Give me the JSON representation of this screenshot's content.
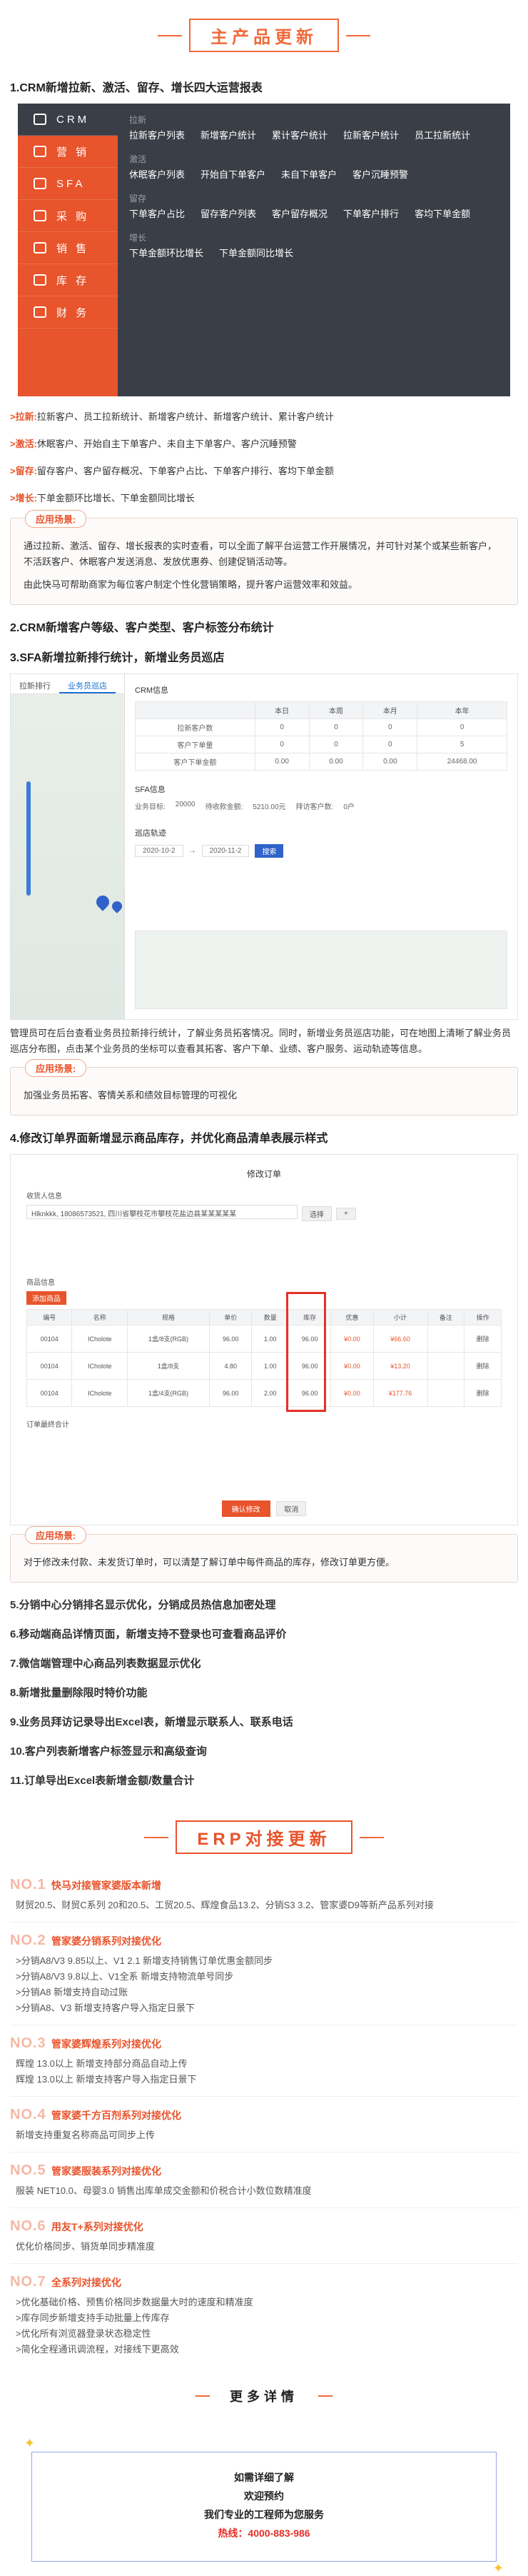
{
  "main_update": {
    "heading": "主产品更新",
    "item1": {
      "title": "1.CRM新增拉新、激活、留存、增长四大运营报表",
      "menu": {
        "nav": [
          "CRM",
          "营 销",
          "SFA",
          "采 购",
          "销 售",
          "库 存",
          "财 务"
        ],
        "groups": [
          {
            "title": "拉新",
            "items": [
              "拉新客户列表",
              "新增客户统计",
              "累计客户统计",
              "拉新客户统计",
              "员工拉新统计"
            ]
          },
          {
            "title": "激活",
            "items": [
              "休眠客户列表",
              "开始自下单客户",
              "未自下单客户",
              "客户沉睡预警"
            ]
          },
          {
            "title": "留存",
            "items": [
              "下单客户占比",
              "留存客户列表",
              "客户留存概况",
              "下单客户排行",
              "客均下单金额"
            ]
          },
          {
            "title": "增长",
            "items": [
              "下单金额环比增长",
              "下单金额同比增长"
            ]
          }
        ]
      },
      "bullets": [
        {
          "key": ">拉新:",
          "text": "拉新客户、员工拉新统计、新增客户统计、新增客户统计、累计客户统计"
        },
        {
          "key": ">激活:",
          "text": "休眠客户、开始自主下单客户、未自主下单客户、客户沉睡预警"
        },
        {
          "key": ">留存:",
          "text": "留存客户、客户留存概况、下单客户占比、下单客户排行、客均下单金额"
        },
        {
          "key": ">增长:",
          "text": "下单金额环比增长、下单金额同比增长"
        }
      ],
      "scene_tag": "应用场景:",
      "scene_text": [
        "通过拉新、激活、留存、增长报表的实时查看，可以全面了解平台运营工作开展情况，并可针对某个或某些新客户，不活跃客户、休眠客户发送消息、发放优惠券、创建促销活动等。",
        "由此快马可帮助商家为每位客户制定个性化营销策略，提升客户运营效率和效益。"
      ]
    },
    "item2": {
      "title": "2.CRM新增客户等级、客户类型、客户标签分布统计"
    },
    "item3": {
      "title": "3.SFA新增拉新排行统计，新增业务员巡店",
      "shot": {
        "tabs": [
          "拉新排行",
          "业务员巡店"
        ],
        "section1": "CRM信息",
        "cols": [
          "",
          "本日",
          "本周",
          "本月",
          "本年"
        ],
        "rows": [
          [
            "拉新客户数",
            "0",
            "0",
            "0",
            "0"
          ],
          [
            "客户下单量",
            "0",
            "0",
            "0",
            "5"
          ],
          [
            "客户下单金额",
            "0.00",
            "0.00",
            "0.00",
            "24468.00"
          ]
        ],
        "section2": "SFA信息",
        "info": [
          "业务目标:",
          "20000",
          "待收款金额:",
          "5210.00元",
          "拜访客户数:",
          "0户"
        ],
        "section3": "巡店轨迹",
        "date_from": "2020-10-2",
        "date_to": "2020-11-2",
        "search": "搜索"
      },
      "para": "管理员可在后台查看业务员拉新排行统计，了解业务员拓客情况。同时，新增业务员巡店功能，可在地图上清晰了解业务员巡店分布图，点击某个业务员的坐标可以查看其拓客、客户下单、业绩、客户服务、运动轨迹等信息。",
      "scene_tag": "应用场景:",
      "scene_text": [
        "加强业务员拓客、客情关系和绩效目标管理的可视化"
      ]
    },
    "item4": {
      "title": "4.修改订单界面新增显示商品库存，并优化商品清单表展示样式",
      "shot": {
        "header": "修改订单",
        "receiver_label": "收货人信息",
        "receiver": "Hlknkkk, 18086573521, 四川省攀枝花市攀枝花盐边县某某某某某",
        "select_btn": "选择",
        "plus_btn": "+",
        "list_label": "商品信息",
        "add_btn": "添加商品",
        "cols": [
          "编号",
          "名称",
          "规格",
          "单价",
          "数量",
          "库存",
          "优惠",
          "小计",
          "备注",
          "操作"
        ],
        "rows": [
          [
            "00104",
            "ICholote",
            "1盒/8支(RGB)",
            "96.00",
            "1.00",
            "96.00",
            "¥0.00",
            "¥66.60",
            "",
            "删除"
          ],
          [
            "00104",
            "ICholote",
            "1盒/8支",
            "4.80",
            "1.00",
            "96.00",
            "¥0.00",
            "¥13.20",
            "",
            "删除"
          ],
          [
            "00104",
            "ICholote",
            "1盒/4支(RGB)",
            "96.00",
            "2.00",
            "96.00",
            "¥0.00",
            "¥177.76",
            "",
            "删除"
          ]
        ],
        "total_label": "订单最终合计",
        "confirm": "确认修改",
        "cancel": "取消"
      },
      "scene_tag": "应用场景:",
      "scene_text": [
        "对于修改未付款、未发货订单时，可以清楚了解订单中每件商品的库存，修改订单更方便。"
      ]
    },
    "more_items": [
      "5.分销中心分销排名显示优化，分销成员热信息加密处理",
      "6.移动端商品详情页面，新增支持不登录也可查看商品评价",
      "7.微信端管理中心商品列表数据显示优化",
      "8.新增批量删除限时特价功能",
      "9.业务员拜访记录导出Excel表，新增显示联系人、联系电话",
      "10.客户列表新增客户标签显示和高级查询",
      "11.订单导出Excel表新增金额/数量合计"
    ]
  },
  "erp_update": {
    "heading": "ERP对接更新",
    "items": [
      {
        "num": "NO.1",
        "title": "快马对接管家婆版本新增",
        "lines": [
          "财贸20.5、财贸C系列 20和20.5、工贸20.5、辉煌食品13.2、分销S3 3.2、管家婆D9等新产品系列对接"
        ]
      },
      {
        "num": "NO.2",
        "title": "管家婆分销系列对接优化",
        "lines": [
          ">分销A8/V3 9.85以上、V1 2.1 新增支持销售订单优惠金额同步",
          ">分销A8/V3 9.8以上、V1全系 新增支持物流单号同步",
          ">分销A8 新增支持自动过账",
          ">分销A8、V3 新增支持客户导入指定日景下"
        ]
      },
      {
        "num": "NO.3",
        "title": "管家婆辉煌系列对接优化",
        "lines": [
          "辉煌 13.0以上 新增支持部分商品自动上传",
          "辉煌 13.0以上 新增支持客户导入指定日景下"
        ]
      },
      {
        "num": "NO.4",
        "title": "管家婆千方百剂系列对接优化",
        "lines": [
          "新增支持重复名称商品可同步上传"
        ]
      },
      {
        "num": "NO.5",
        "title": "管家婆服装系列对接优化",
        "lines": [
          "服装 NET10.0、母婴3.0 销售出库单成交金额和价税合计小数位数精准度"
        ]
      },
      {
        "num": "NO.6",
        "title": "用友T+系列对接优化",
        "lines": [
          "优化价格同步、销货单同步精准度"
        ]
      },
      {
        "num": "NO.7",
        "title": "全系列对接优化",
        "lines": [
          ">优化基础价格、预售价格同步数据量大时的速度和精准度",
          ">库存同步新增支持手动批量上传库存",
          ">优化所有浏览器登录状态稳定性",
          ">简化全程通讯调流程，对接线下更高效"
        ]
      }
    ]
  },
  "more_detail": {
    "heading": "更多详情",
    "lines": [
      "如需详细了解",
      "欢迎预约",
      "我们专业的工程师为您服务"
    ],
    "hotline": "热线：4000-883-986"
  },
  "colors": {
    "accent": "#e8542c",
    "dark_panel": "#3a3f47",
    "highlight": "#e4312a"
  }
}
